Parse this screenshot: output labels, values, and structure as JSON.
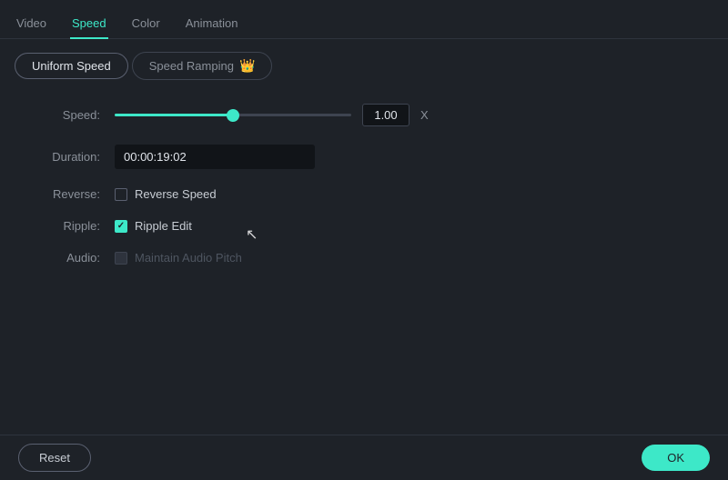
{
  "nav": {
    "tabs": [
      {
        "id": "video",
        "label": "Video",
        "active": false
      },
      {
        "id": "speed",
        "label": "Speed",
        "active": true
      },
      {
        "id": "color",
        "label": "Color",
        "active": false
      },
      {
        "id": "animation",
        "label": "Animation",
        "active": false
      }
    ]
  },
  "subtabs": {
    "uniform": {
      "label": "Uniform Speed",
      "active": true
    },
    "ramp": {
      "label": "Speed Ramping",
      "icon": "👑"
    }
  },
  "form": {
    "speed_label": "Speed:",
    "speed_value": "1.00",
    "speed_x": "X",
    "duration_label": "Duration:",
    "duration_value": "00:00:19:02",
    "reverse_label": "Reverse:",
    "reverse_checkbox_label": "Reverse Speed",
    "reverse_checked": false,
    "ripple_label": "Ripple:",
    "ripple_checkbox_label": "Ripple Edit",
    "ripple_checked": true,
    "audio_label": "Audio:",
    "audio_checkbox_label": "Maintain Audio Pitch",
    "audio_disabled": true
  },
  "footer": {
    "reset_label": "Reset",
    "ok_label": "OK"
  }
}
